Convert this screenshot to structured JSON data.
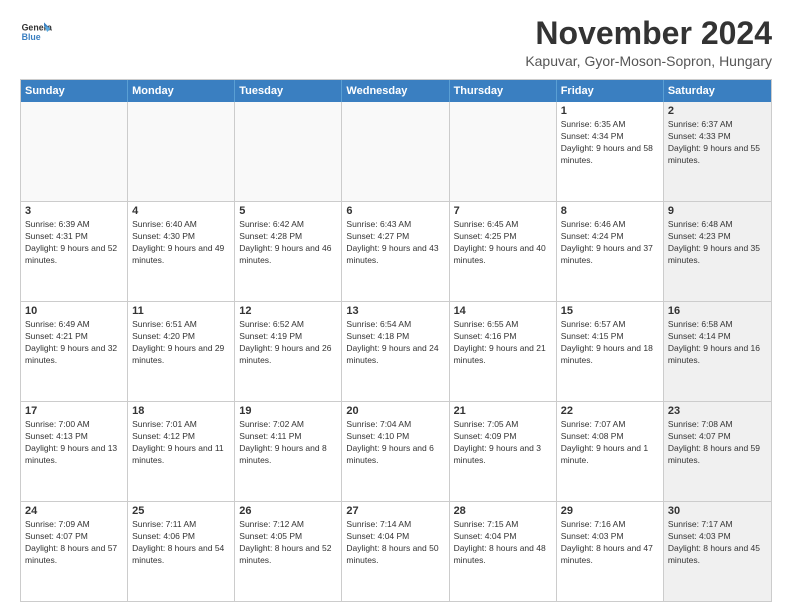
{
  "header": {
    "logo_line1": "General",
    "logo_line2": "Blue",
    "month": "November 2024",
    "location": "Kapuvar, Gyor-Moson-Sopron, Hungary"
  },
  "days_of_week": [
    "Sunday",
    "Monday",
    "Tuesday",
    "Wednesday",
    "Thursday",
    "Friday",
    "Saturday"
  ],
  "weeks": [
    [
      {
        "day": "",
        "empty": true
      },
      {
        "day": "",
        "empty": true
      },
      {
        "day": "",
        "empty": true
      },
      {
        "day": "",
        "empty": true
      },
      {
        "day": "",
        "empty": true
      },
      {
        "day": "1",
        "sunrise": "6:35 AM",
        "sunset": "4:34 PM",
        "daylight": "9 hours and 58 minutes."
      },
      {
        "day": "2",
        "sunrise": "6:37 AM",
        "sunset": "4:33 PM",
        "daylight": "9 hours and 55 minutes."
      }
    ],
    [
      {
        "day": "3",
        "sunrise": "6:39 AM",
        "sunset": "4:31 PM",
        "daylight": "9 hours and 52 minutes."
      },
      {
        "day": "4",
        "sunrise": "6:40 AM",
        "sunset": "4:30 PM",
        "daylight": "9 hours and 49 minutes."
      },
      {
        "day": "5",
        "sunrise": "6:42 AM",
        "sunset": "4:28 PM",
        "daylight": "9 hours and 46 minutes."
      },
      {
        "day": "6",
        "sunrise": "6:43 AM",
        "sunset": "4:27 PM",
        "daylight": "9 hours and 43 minutes."
      },
      {
        "day": "7",
        "sunrise": "6:45 AM",
        "sunset": "4:25 PM",
        "daylight": "9 hours and 40 minutes."
      },
      {
        "day": "8",
        "sunrise": "6:46 AM",
        "sunset": "4:24 PM",
        "daylight": "9 hours and 37 minutes."
      },
      {
        "day": "9",
        "sunrise": "6:48 AM",
        "sunset": "4:23 PM",
        "daylight": "9 hours and 35 minutes."
      }
    ],
    [
      {
        "day": "10",
        "sunrise": "6:49 AM",
        "sunset": "4:21 PM",
        "daylight": "9 hours and 32 minutes."
      },
      {
        "day": "11",
        "sunrise": "6:51 AM",
        "sunset": "4:20 PM",
        "daylight": "9 hours and 29 minutes."
      },
      {
        "day": "12",
        "sunrise": "6:52 AM",
        "sunset": "4:19 PM",
        "daylight": "9 hours and 26 minutes."
      },
      {
        "day": "13",
        "sunrise": "6:54 AM",
        "sunset": "4:18 PM",
        "daylight": "9 hours and 24 minutes."
      },
      {
        "day": "14",
        "sunrise": "6:55 AM",
        "sunset": "4:16 PM",
        "daylight": "9 hours and 21 minutes."
      },
      {
        "day": "15",
        "sunrise": "6:57 AM",
        "sunset": "4:15 PM",
        "daylight": "9 hours and 18 minutes."
      },
      {
        "day": "16",
        "sunrise": "6:58 AM",
        "sunset": "4:14 PM",
        "daylight": "9 hours and 16 minutes."
      }
    ],
    [
      {
        "day": "17",
        "sunrise": "7:00 AM",
        "sunset": "4:13 PM",
        "daylight": "9 hours and 13 minutes."
      },
      {
        "day": "18",
        "sunrise": "7:01 AM",
        "sunset": "4:12 PM",
        "daylight": "9 hours and 11 minutes."
      },
      {
        "day": "19",
        "sunrise": "7:02 AM",
        "sunset": "4:11 PM",
        "daylight": "9 hours and 8 minutes."
      },
      {
        "day": "20",
        "sunrise": "7:04 AM",
        "sunset": "4:10 PM",
        "daylight": "9 hours and 6 minutes."
      },
      {
        "day": "21",
        "sunrise": "7:05 AM",
        "sunset": "4:09 PM",
        "daylight": "9 hours and 3 minutes."
      },
      {
        "day": "22",
        "sunrise": "7:07 AM",
        "sunset": "4:08 PM",
        "daylight": "9 hours and 1 minute."
      },
      {
        "day": "23",
        "sunrise": "7:08 AM",
        "sunset": "4:07 PM",
        "daylight": "8 hours and 59 minutes."
      }
    ],
    [
      {
        "day": "24",
        "sunrise": "7:09 AM",
        "sunset": "4:07 PM",
        "daylight": "8 hours and 57 minutes."
      },
      {
        "day": "25",
        "sunrise": "7:11 AM",
        "sunset": "4:06 PM",
        "daylight": "8 hours and 54 minutes."
      },
      {
        "day": "26",
        "sunrise": "7:12 AM",
        "sunset": "4:05 PM",
        "daylight": "8 hours and 52 minutes."
      },
      {
        "day": "27",
        "sunrise": "7:14 AM",
        "sunset": "4:04 PM",
        "daylight": "8 hours and 50 minutes."
      },
      {
        "day": "28",
        "sunrise": "7:15 AM",
        "sunset": "4:04 PM",
        "daylight": "8 hours and 48 minutes."
      },
      {
        "day": "29",
        "sunrise": "7:16 AM",
        "sunset": "4:03 PM",
        "daylight": "8 hours and 47 minutes."
      },
      {
        "day": "30",
        "sunrise": "7:17 AM",
        "sunset": "4:03 PM",
        "daylight": "8 hours and 45 minutes."
      }
    ]
  ]
}
